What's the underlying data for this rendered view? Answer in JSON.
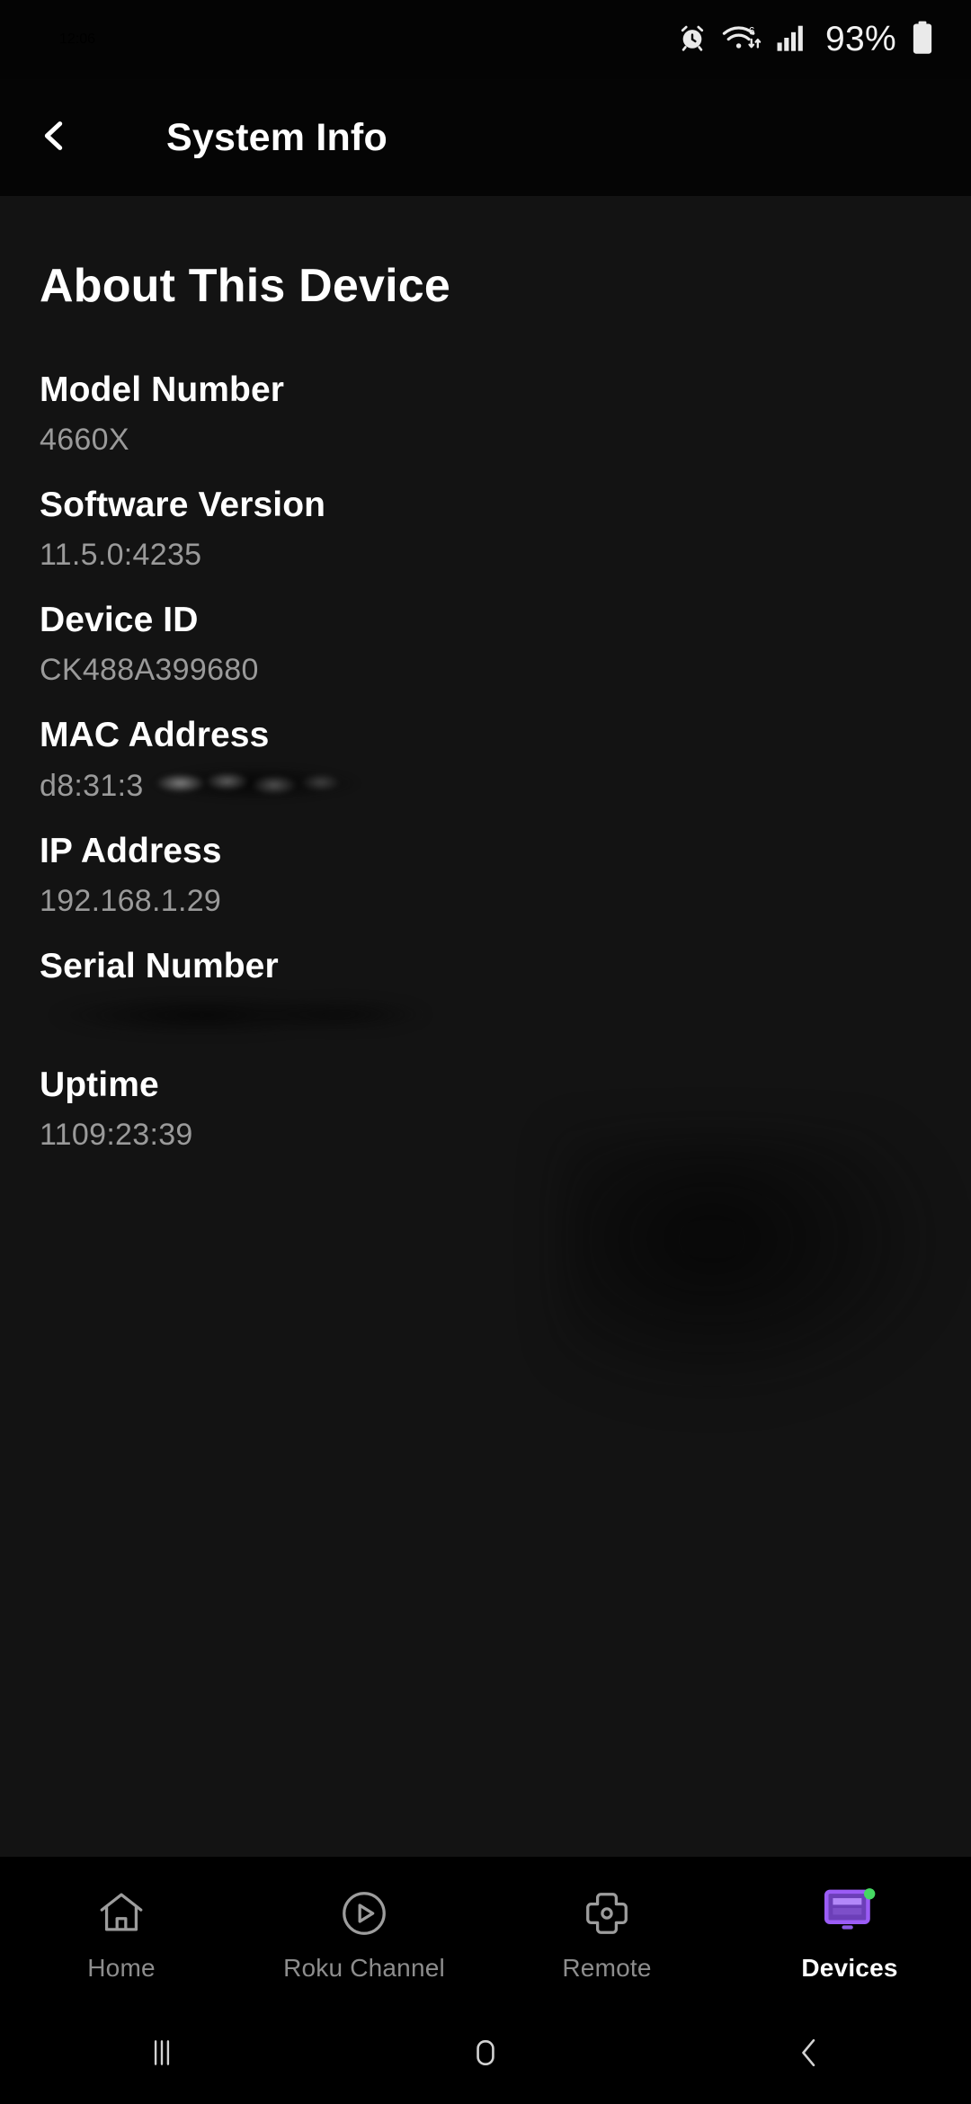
{
  "status_bar": {
    "time": "12:06",
    "battery_percent": "93%",
    "icons": [
      "alarm-clock-icon",
      "wifi-6-icon",
      "cellular-signal-icon",
      "battery-icon"
    ]
  },
  "header": {
    "back_icon": "chevron-left-icon",
    "title": "System Info"
  },
  "content": {
    "section_title": "About This Device",
    "items": [
      {
        "label": "Model Number",
        "value": "4660X",
        "redaction": "none"
      },
      {
        "label": "Software Version",
        "value": "11.5.0:4235",
        "redaction": "none"
      },
      {
        "label": "Device ID",
        "value": "CK488A399680",
        "redaction": "none"
      },
      {
        "label": "MAC Address",
        "value": "d8:31:3",
        "redaction": "partial"
      },
      {
        "label": "IP Address",
        "value": "192.168.1.29",
        "redaction": "none"
      },
      {
        "label": "Serial Number",
        "value": "",
        "redaction": "full"
      },
      {
        "label": "Uptime",
        "value": "1109:23:39",
        "redaction": "none"
      }
    ]
  },
  "tab_bar": {
    "active_index": 3,
    "active_color": "#9b5cf6",
    "status_dot_color": "#45d962",
    "items": [
      {
        "label": "Home",
        "icon": "home-icon"
      },
      {
        "label": "Roku Channel",
        "icon": "play-circle-icon"
      },
      {
        "label": "Remote",
        "icon": "dpad-icon"
      },
      {
        "label": "Devices",
        "icon": "tv-device-icon"
      }
    ]
  },
  "nav_bar": {
    "items": [
      {
        "name": "recents",
        "icon": "recents-icon"
      },
      {
        "name": "home",
        "icon": "home-square-icon"
      },
      {
        "name": "back",
        "icon": "back-chevron-icon"
      }
    ]
  }
}
